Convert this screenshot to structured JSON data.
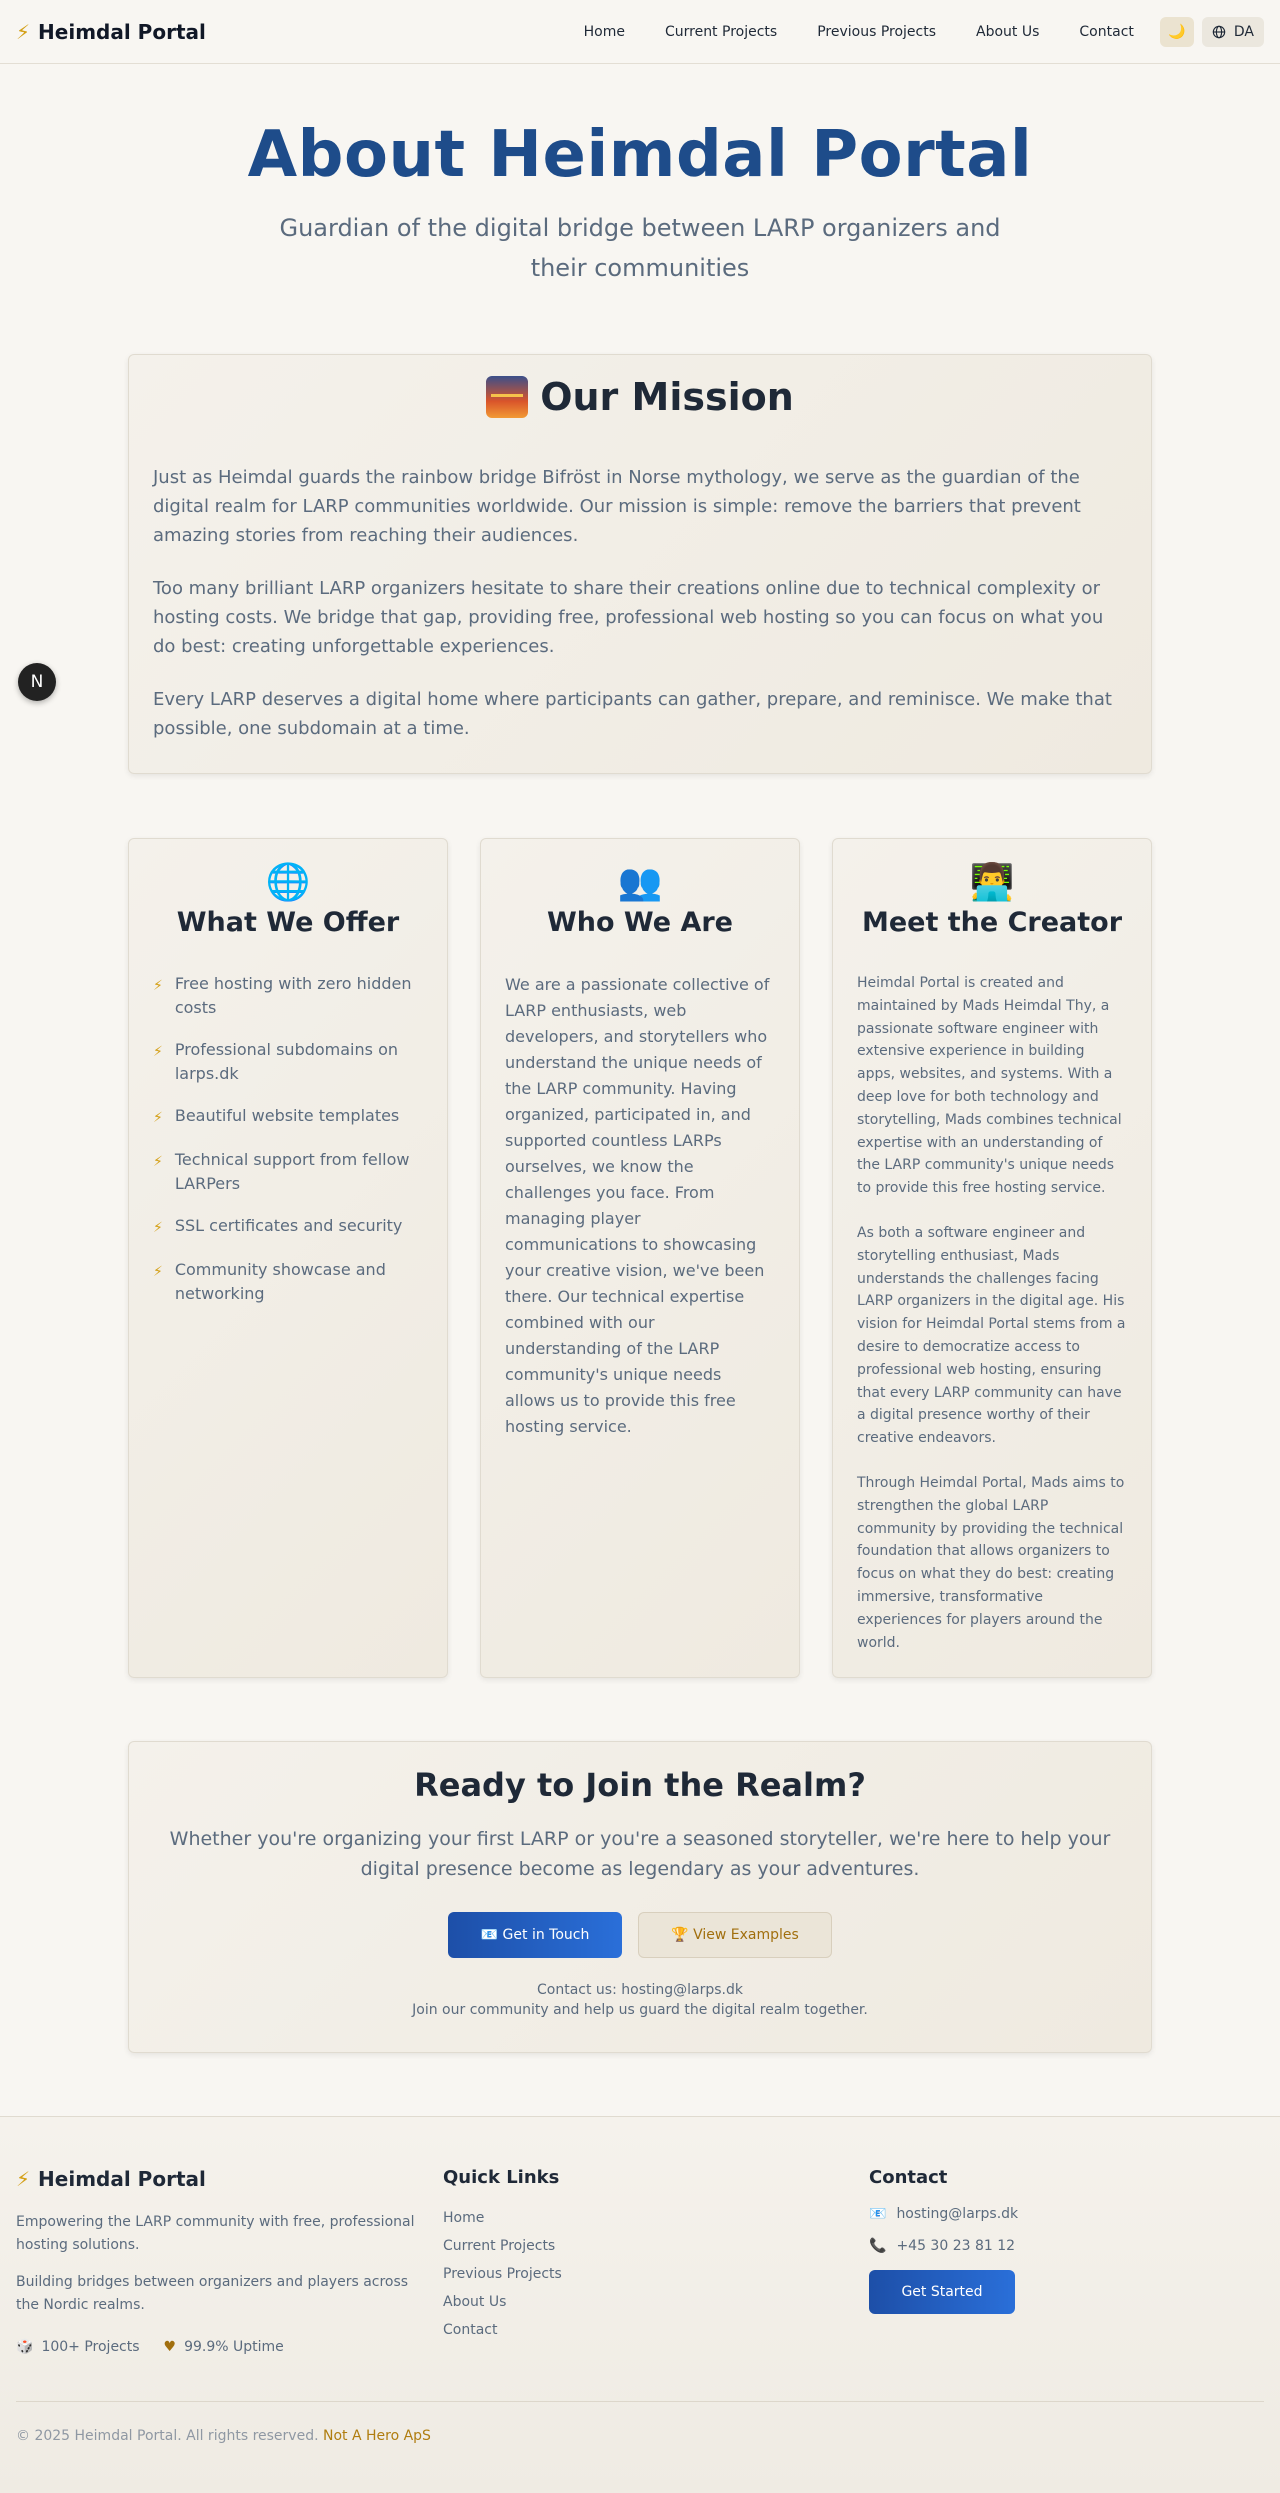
{
  "header": {
    "brand": "Heimdal Portal",
    "brand_icon": "⚡",
    "nav": [
      "Home",
      "Current Projects",
      "Previous Projects",
      "About Us",
      "Contact"
    ],
    "theme_icon": "🌙",
    "lang_icon": "globe-icon",
    "lang_label": "DA"
  },
  "hero": {
    "title": "About Heimdal Portal",
    "subtitle": "Guardian of the digital bridge between LARP organizers and their communities"
  },
  "mission": {
    "title": "Our Mission",
    "paragraphs": [
      "Just as Heimdal guards the rainbow bridge Bifröst in Norse mythology, we serve as the guardian of the digital realm for LARP communities worldwide. Our mission is simple: remove the barriers that prevent amazing stories from reaching their audiences.",
      "Too many brilliant LARP organizers hesitate to share their creations online due to technical complexity or hosting costs. We bridge that gap, providing free, professional web hosting so you can focus on what you do best: creating unforgettable experiences.",
      "Every LARP deserves a digital home where participants can gather, prepare, and reminisce. We make that possible, one subdomain at a time."
    ]
  },
  "offer": {
    "icon": "🌐",
    "title": "What We Offer",
    "items": [
      "Free hosting with zero hidden costs",
      "Professional subdomains on larps.dk",
      "Beautiful website templates",
      "Technical support from fellow LARPers",
      "SSL certificates and security",
      "Community showcase and networking"
    ]
  },
  "who": {
    "icon": "👥",
    "title": "Who We Are",
    "text": "We are a passionate collective of LARP enthusiasts, web developers, and storytellers who understand the unique needs of the LARP community. Having organized, participated in, and supported countless LARPs ourselves, we know the challenges you face. From managing player communications to showcasing your creative vision, we've been there. Our technical expertise combined with our understanding of the LARP community's unique needs allows us to provide this free hosting service."
  },
  "creator": {
    "icon": "👨‍💻",
    "title": "Meet the Creator",
    "paragraphs": [
      "Heimdal Portal is created and maintained by Mads Heimdal Thy, a passionate software engineer with extensive experience in building apps, websites, and systems. With a deep love for both technology and storytelling, Mads combines technical expertise with an understanding of the LARP community's unique needs to provide this free hosting service.",
      "As both a software engineer and storytelling enthusiast, Mads understands the challenges facing LARP organizers in the digital age. His vision for Heimdal Portal stems from a desire to democratize access to professional web hosting, ensuring that every LARP community can have a digital presence worthy of their creative endeavors.",
      "Through Heimdal Portal, Mads aims to strengthen the global LARP community by providing the technical foundation that allows organizers to focus on what they do best: creating immersive, transformative experiences for players around the world."
    ]
  },
  "cta": {
    "title": "Ready to Join the Realm?",
    "text": "Whether you're organizing your first LARP or you're a seasoned storyteller, we're here to help your digital presence become as legendary as your adventures.",
    "primary_button": "📧 Get in Touch",
    "secondary_button": "🏆 View Examples",
    "contact_line": "Contact us: hosting@larps.dk",
    "join_line": "Join our community and help us guard the digital realm together."
  },
  "fab_label": "N",
  "footer": {
    "brand": "Heimdal Portal",
    "brand_icon": "⚡",
    "text1": "Empowering the LARP community with free, professional hosting solutions.",
    "text2": "Building bridges between organizers and players across the Nordic realms.",
    "stat1_icon": "🎲",
    "stat1": "100+ Projects",
    "stat2_icon": "♥",
    "stat2": "99.9% Uptime",
    "quick_links_title": "Quick Links",
    "quick_links": [
      "Home",
      "Current Projects",
      "Previous Projects",
      "About Us",
      "Contact"
    ],
    "contact_title": "Contact",
    "email_icon": "📧",
    "email": "hosting@larps.dk",
    "phone_icon": "📞",
    "phone": "+45 30 23 81 12",
    "cta_button": "Get Started",
    "copyright": "© 2025 Heimdal Portal. All rights reserved.",
    "company": "Not A Hero ApS"
  },
  "colors": {
    "background": "#f8f6f2",
    "title_blue": "#1e4c8a",
    "accent_gold": "#d4a017",
    "primary_button": "#1d4fa8"
  }
}
